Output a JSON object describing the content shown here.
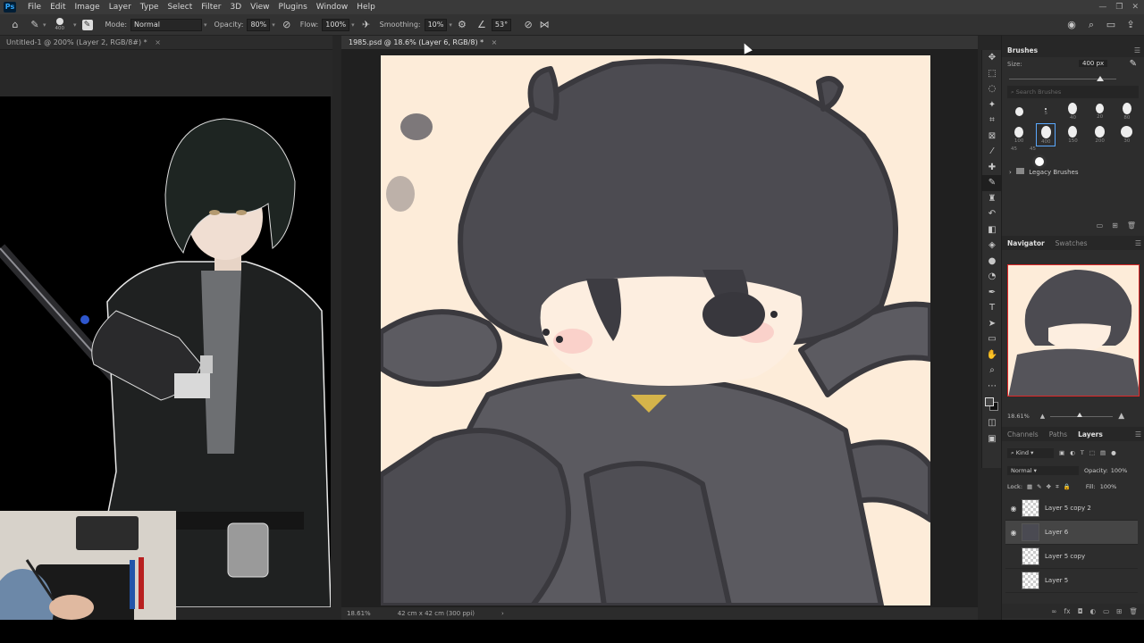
{
  "app": {
    "logo": "Ps",
    "menu": [
      "File",
      "Edit",
      "Image",
      "Layer",
      "Type",
      "Select",
      "Filter",
      "3D",
      "View",
      "Plugins",
      "Window",
      "Help"
    ]
  },
  "options": {
    "brush_size": "400",
    "mode_label": "Mode:",
    "mode_value": "Normal",
    "opacity_label": "Opacity:",
    "opacity_value": "80%",
    "flow_label": "Flow:",
    "flow_value": "100%",
    "smoothing_label": "Smoothing:",
    "smoothing_value": "10%",
    "angle_value": "53°"
  },
  "documents": {
    "left_tab": "Untitled-1 @ 200% (Layer 2, RGB/8#) *",
    "main_tab": "1985.psd @ 18.6% (Layer 6, RGB/8) *",
    "status_zoom": "18.61%",
    "status_size": "42 cm x 42 cm (300 ppi)"
  },
  "brushes_panel": {
    "title": "Brushes",
    "size_label": "Size:",
    "size_value": "400 px",
    "search_placeholder": "Search Brushes",
    "row1": [
      "",
      "5",
      "40",
      "20",
      "80"
    ],
    "row2": [
      "100",
      "400",
      "150",
      "200",
      "30"
    ],
    "row3": [
      "45",
      "45"
    ],
    "folder": "Legacy Brushes"
  },
  "navigator_panel": {
    "tabs": [
      "Navigator",
      "Swatches"
    ],
    "zoom": "18.61%"
  },
  "layers_panel": {
    "tabs": [
      "Channels",
      "Paths",
      "Layers"
    ],
    "filter": "Kind",
    "blend_mode": "Normal",
    "opacity_label": "Opacity:",
    "opacity_value": "100%",
    "lock_label": "Lock:",
    "fill_label": "Fill:",
    "fill_value": "100%",
    "layers": [
      {
        "name": "Layer 5 copy 2",
        "visible": true
      },
      {
        "name": "Layer 6",
        "visible": true,
        "selected": true
      },
      {
        "name": "Layer 5 copy",
        "visible": false
      },
      {
        "name": "Layer 5",
        "visible": false
      }
    ]
  },
  "colors": {
    "accent": "#31a8ff",
    "canvas_bg": "#fdecd9",
    "ink": "#48474d"
  }
}
